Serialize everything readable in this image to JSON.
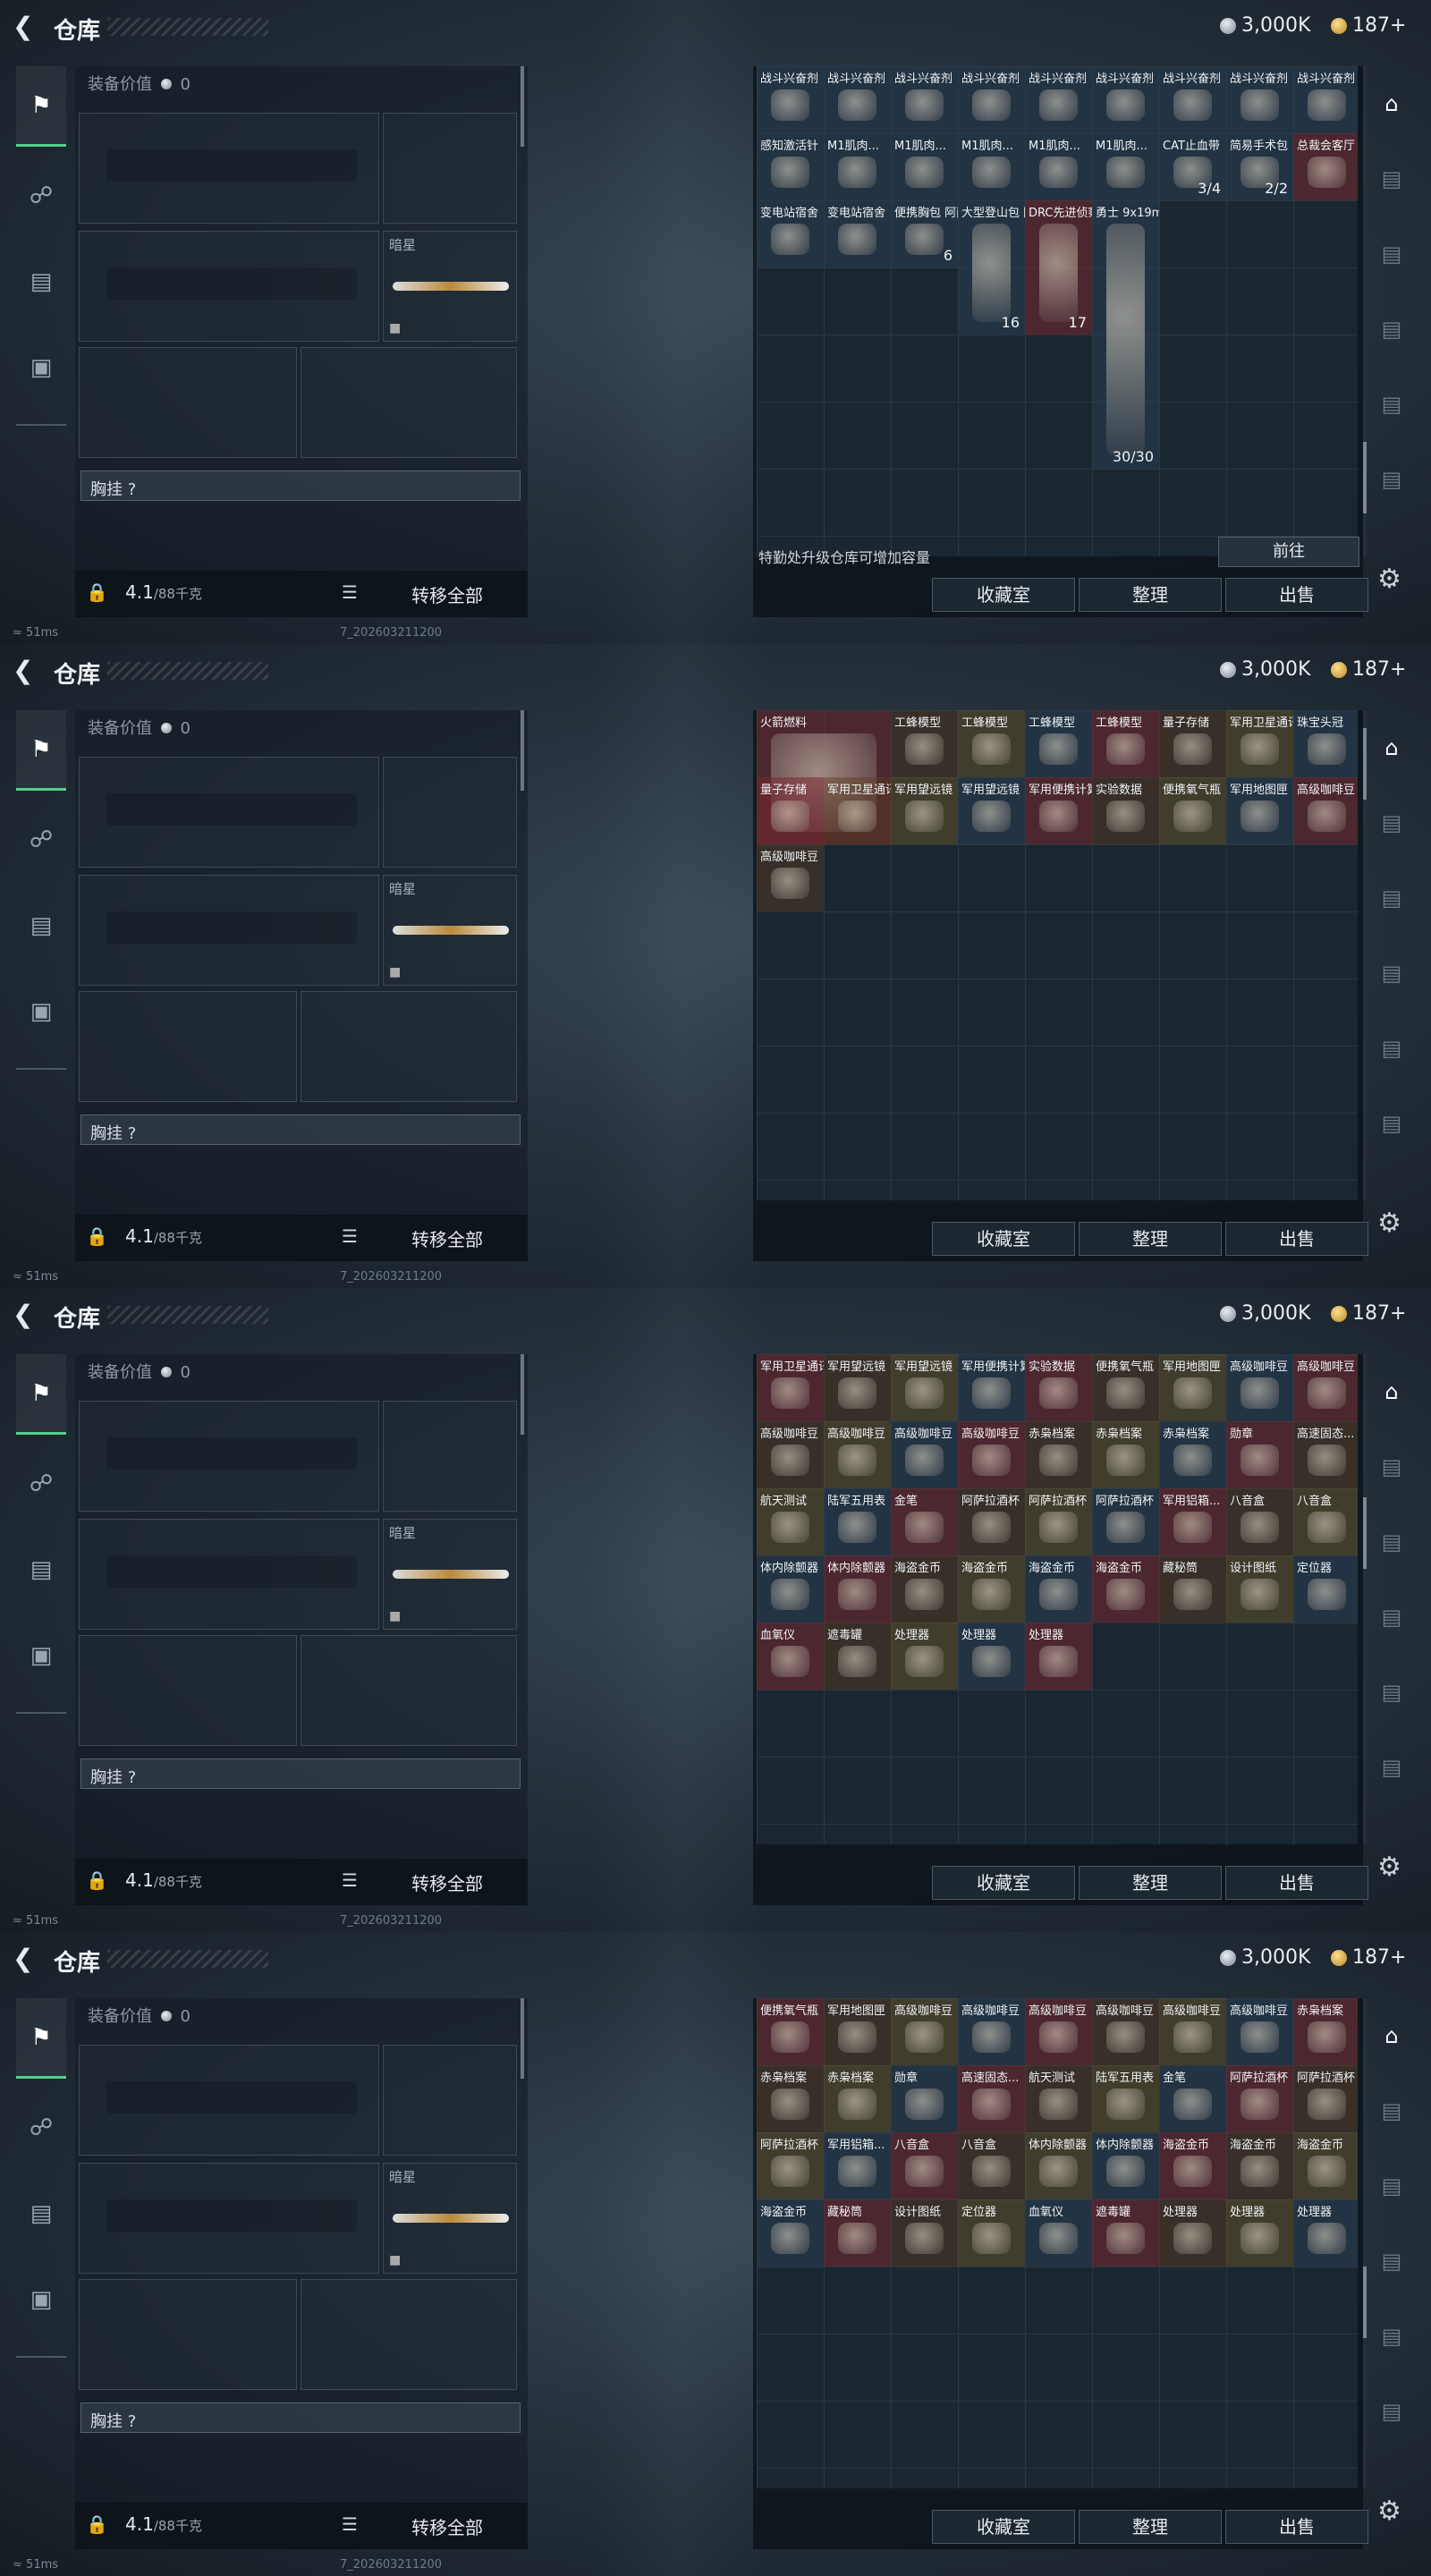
{
  "panels": [
    {
      "variant": "a",
      "title": "仓库",
      "silver": "3,000K",
      "gold": "187+",
      "equip_value_label": "装备价值",
      "equip_value": "0",
      "knife_label": "暗星",
      "chest_label": "胸挂 ?",
      "weight": "4.1",
      "weight_max": "/88千克",
      "transfer_all": "转移全部",
      "status": "51ms",
      "version": "7_202603211200",
      "upgrade_hint": "特勤处升级仓库可增加容量",
      "goto": "前往",
      "btn_collect": "收藏室",
      "btn_sort": "整理",
      "btn_sell": "出售",
      "items": [
        {
          "label": "战斗兴奋剂",
          "color": "blue"
        },
        {
          "label": "战斗兴奋剂",
          "color": "blue"
        },
        {
          "label": "战斗兴奋剂",
          "color": "blue"
        },
        {
          "label": "战斗兴奋剂",
          "color": "blue"
        },
        {
          "label": "战斗兴奋剂",
          "color": "blue"
        },
        {
          "label": "战斗兴奋剂",
          "color": "blue"
        },
        {
          "label": "战斗兴奋剂",
          "color": "blue"
        },
        {
          "label": "战斗兴奋剂",
          "color": "blue"
        },
        {
          "label": "战斗兴奋剂",
          "color": "blue"
        },
        {
          "label": "感知激活针",
          "color": "blue"
        },
        {
          "label": "M1肌肉...",
          "color": "blue"
        },
        {
          "label": "M1肌肉...",
          "color": "blue"
        },
        {
          "label": "M1肌肉...",
          "color": "blue"
        },
        {
          "label": "M1肌肉...",
          "color": "blue"
        },
        {
          "label": "M1肌肉...",
          "color": "blue"
        },
        {
          "label": "CAT止血带",
          "color": "blue",
          "count": "3/4"
        },
        {
          "label": "简易手术包",
          "color": "blue",
          "count": "2/2"
        },
        {
          "label": "总裁会客厅",
          "color": "red"
        },
        {
          "label": "变电站宿舍",
          "color": "blue"
        },
        {
          "label": "变电站宿舍",
          "color": "blue"
        },
        {
          "label": "便携胸包 阿萨拉",
          "color": "blue",
          "count": "6"
        },
        {
          "label": "大型登山包 阿萨拉",
          "color": "blue",
          "count": "16"
        },
        {
          "label": "DRC先进侦察胸挂 三角洲",
          "color": "red",
          "count": "17"
        },
        {
          "label": "勇士 9x19mm",
          "color": "blue",
          "count": "30/30"
        }
      ]
    },
    {
      "variant": "b",
      "title": "仓库",
      "silver": "3,000K",
      "gold": "187+",
      "equip_value_label": "装备价值",
      "equip_value": "0",
      "knife_label": "暗星",
      "chest_label": "胸挂 ?",
      "weight": "4.1",
      "weight_max": "/88千克",
      "transfer_all": "转移全部",
      "status": "51ms",
      "version": "7_202603211200",
      "btn_collect": "收藏室",
      "btn_sort": "整理",
      "btn_sell": "出售",
      "items": [
        {
          "label": "火箭燃料"
        },
        {
          "label": "工蜂模型"
        },
        {
          "label": "工蜂模型"
        },
        {
          "label": "工蜂模型"
        },
        {
          "label": "工蜂模型"
        },
        {
          "label": "量子存储"
        },
        {
          "label": "军用卫星通讯仪"
        },
        {
          "label": "珠宝头冠"
        },
        {
          "label": "量子存储"
        },
        {
          "label": "军用卫星通讯仪"
        },
        {
          "label": "军用望远镜"
        },
        {
          "label": "军用望远镜"
        },
        {
          "label": "军用便携计算机"
        },
        {
          "label": "实验数据"
        },
        {
          "label": "便携氧气瓶"
        },
        {
          "label": "军用地图匣"
        },
        {
          "label": "高级咖啡豆"
        },
        {
          "label": "高级咖啡豆"
        }
      ]
    },
    {
      "variant": "c",
      "title": "仓库",
      "silver": "3,000K",
      "gold": "187+",
      "equip_value_label": "装备价值",
      "equip_value": "0",
      "knife_label": "暗星",
      "chest_label": "胸挂 ?",
      "weight": "4.1",
      "weight_max": "/88千克",
      "transfer_all": "转移全部",
      "status": "51ms",
      "version": "7_202603211200",
      "btn_collect": "收藏室",
      "btn_sort": "整理",
      "btn_sell": "出售",
      "items": [
        {
          "label": "军用卫星通讯仪"
        },
        {
          "label": "军用望远镜"
        },
        {
          "label": "军用望远镜"
        },
        {
          "label": "军用便携计算机"
        },
        {
          "label": "实验数据"
        },
        {
          "label": "便携氧气瓶"
        },
        {
          "label": "军用地图匣"
        },
        {
          "label": "高级咖啡豆"
        },
        {
          "label": "高级咖啡豆"
        },
        {
          "label": "高级咖啡豆"
        },
        {
          "label": "高级咖啡豆"
        },
        {
          "label": "高级咖啡豆"
        },
        {
          "label": "高级咖啡豆"
        },
        {
          "label": "赤枭档案"
        },
        {
          "label": "赤枭档案"
        },
        {
          "label": "赤枭档案"
        },
        {
          "label": "勋章"
        },
        {
          "label": "高速固态..."
        },
        {
          "label": "航天测试"
        },
        {
          "label": "陆军五用表"
        },
        {
          "label": "金笔"
        },
        {
          "label": "阿萨拉酒杯"
        },
        {
          "label": "阿萨拉酒杯"
        },
        {
          "label": "阿萨拉酒杯"
        },
        {
          "label": "军用铝箱..."
        },
        {
          "label": "八音盒"
        },
        {
          "label": "八音盒"
        },
        {
          "label": "体内除颤器"
        },
        {
          "label": "体内除颤器"
        },
        {
          "label": "海盗金币"
        },
        {
          "label": "海盗金币"
        },
        {
          "label": "海盗金币"
        },
        {
          "label": "海盗金币"
        },
        {
          "label": "藏秘筒"
        },
        {
          "label": "设计图纸"
        },
        {
          "label": "定位器"
        },
        {
          "label": "血氧仪"
        },
        {
          "label": "遮毒罐"
        },
        {
          "label": "处理器"
        },
        {
          "label": "处理器"
        },
        {
          "label": "处理器"
        }
      ]
    },
    {
      "variant": "d",
      "title": "仓库",
      "silver": "3,000K",
      "gold": "187+",
      "equip_value_label": "装备价值",
      "equip_value": "0",
      "knife_label": "暗星",
      "chest_label": "胸挂 ?",
      "weight": "4.1",
      "weight_max": "/88千克",
      "transfer_all": "转移全部",
      "status": "51ms",
      "version": "7_202603211200",
      "btn_collect": "收藏室",
      "btn_sort": "整理",
      "btn_sell": "出售",
      "items": [
        {
          "label": "便携氧气瓶"
        },
        {
          "label": "军用地图匣"
        },
        {
          "label": "高级咖啡豆"
        },
        {
          "label": "高级咖啡豆"
        },
        {
          "label": "高级咖啡豆"
        },
        {
          "label": "高级咖啡豆"
        },
        {
          "label": "高级咖啡豆"
        },
        {
          "label": "高级咖啡豆"
        },
        {
          "label": "赤枭档案"
        },
        {
          "label": "赤枭档案"
        },
        {
          "label": "赤枭档案"
        },
        {
          "label": "勋章"
        },
        {
          "label": "高速固态..."
        },
        {
          "label": "航天测试"
        },
        {
          "label": "陆军五用表"
        },
        {
          "label": "金笔"
        },
        {
          "label": "阿萨拉酒杯"
        },
        {
          "label": "阿萨拉酒杯"
        },
        {
          "label": "阿萨拉酒杯"
        },
        {
          "label": "军用铝箱..."
        },
        {
          "label": "八音盒"
        },
        {
          "label": "八音盒"
        },
        {
          "label": "体内除颤器"
        },
        {
          "label": "体内除颤器"
        },
        {
          "label": "海盗金币"
        },
        {
          "label": "海盗金币"
        },
        {
          "label": "海盗金币"
        },
        {
          "label": "海盗金币"
        },
        {
          "label": "藏秘筒"
        },
        {
          "label": "设计图纸"
        },
        {
          "label": "定位器"
        },
        {
          "label": "血氧仪"
        },
        {
          "label": "遮毒罐"
        },
        {
          "label": "处理器"
        },
        {
          "label": "处理器"
        },
        {
          "label": "处理器"
        }
      ]
    }
  ]
}
